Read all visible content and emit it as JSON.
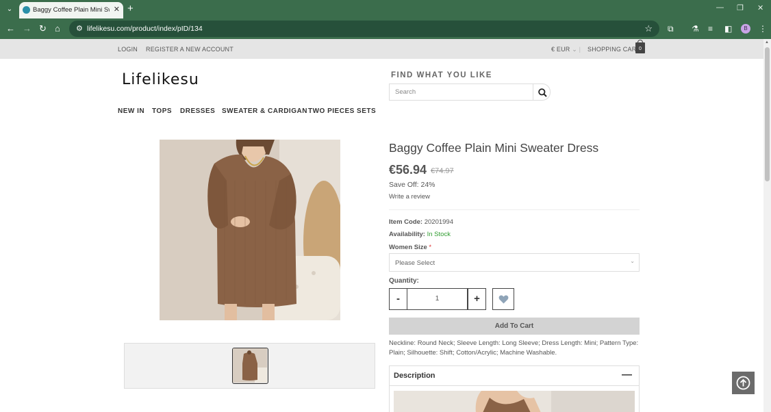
{
  "browser": {
    "tab_title": "Baggy Coffee Plain Mini Sweat",
    "url": "lifelikesu.com/product/index/pID/134",
    "profile_initial": "B"
  },
  "topbar": {
    "login": "LOGIN",
    "register": "REGISTER A NEW ACCOUNT",
    "currency": "€ EUR",
    "cart_label": "SHOPPING CART",
    "cart_count": "0"
  },
  "header": {
    "logo": "Lifelikesu",
    "find_label": "FIND WHAT YOU LIKE",
    "search_placeholder": "Search"
  },
  "nav": {
    "items": [
      "NEW IN",
      "TOPS",
      "DRESSES",
      "SWEATER & CARDIGAN",
      "TWO PIECES SETS"
    ]
  },
  "product": {
    "title": "Baggy Coffee Plain Mini Sweater Dress",
    "price": "€56.94",
    "old_price": "€74.97",
    "save": "Save Off: 24%",
    "review_link": "Write a review",
    "item_code_label": "Item Code:",
    "item_code": "20201994",
    "availability_label": "Availability:",
    "availability": "In Stock",
    "size_label": "Women Size",
    "size_required": "*",
    "size_placeholder": "Please Select",
    "quantity_label": "Quantity:",
    "quantity": "1",
    "minus": "-",
    "plus": "+",
    "add_to_cart": "Add To Cart",
    "features": "Neckline: Round Neck; Sleeve Length: Long Sleeve; Dress Length: Mini; Pattern Type: Plain; Silhouette: Shift; Cotton/Acrylic; Machine Washable.",
    "description_label": "Description",
    "description_toggle": "—"
  },
  "colors": {
    "browser_chrome": "#3b6d4c",
    "sweater": "#8a6246",
    "in_stock": "#2e9c2e"
  },
  "icons": {
    "search": "search-icon",
    "wishlist": "heart-icon",
    "back_to_top": "arrow-up-circle-icon",
    "cart": "shopping-bag-icon"
  }
}
